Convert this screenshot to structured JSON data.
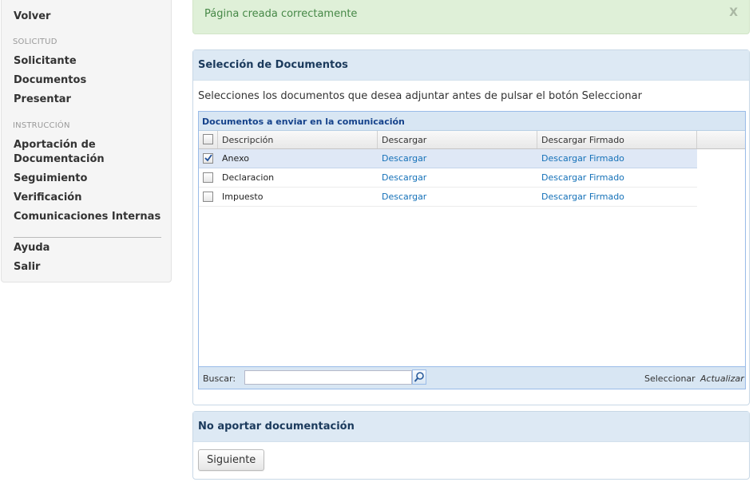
{
  "sidebar": {
    "back": "Volver",
    "section_solicitud": "SOLICITUD",
    "solicitante": "Solicitante",
    "documentos": "Documentos",
    "presentar": "Presentar",
    "section_instruccion": "INSTRUCCIÓN",
    "aportacion_line1": "Aportación de",
    "aportacion_line2": "Documentación",
    "seguimiento": "Seguimiento",
    "verificacion": "Verificación",
    "comunicaciones": "Comunicaciones Internas",
    "ayuda": "Ayuda",
    "salir": "Salir"
  },
  "alert": {
    "message": "Página creada correctamente",
    "close": "X"
  },
  "panel_docs": {
    "title": "Selección de Documentos",
    "instructions": "Selecciones los documentos que desea adjuntar antes de pulsar el botón Seleccionar",
    "grid": {
      "title": "Documentos a enviar en la comunicación",
      "columns": [
        "Descripción",
        "Descargar",
        "Descargar Firmado"
      ],
      "rows": [
        {
          "descripcion": "Anexo",
          "descargar": "Descargar",
          "firmado": "Descargar Firmado",
          "checked": true
        },
        {
          "descripcion": "Declaracion",
          "descargar": "Descargar",
          "firmado": "Descargar Firmado",
          "checked": false
        },
        {
          "descripcion": "Impuesto",
          "descargar": "Descargar",
          "firmado": "Descargar Firmado",
          "checked": false
        }
      ],
      "search_label": "Buscar:",
      "search_value": "",
      "select_label": "Seleccionar",
      "refresh_label": "Actualizar"
    }
  },
  "panel_no_docs": {
    "title": "No aportar documentación",
    "next_button": "Siguiente"
  },
  "colors": {
    "alert_bg": "#dff0d8",
    "alert_text": "#468847",
    "panel_header_bg": "#dde9f4",
    "link": "#1571b8",
    "selected_row": "#dfe8f6"
  }
}
